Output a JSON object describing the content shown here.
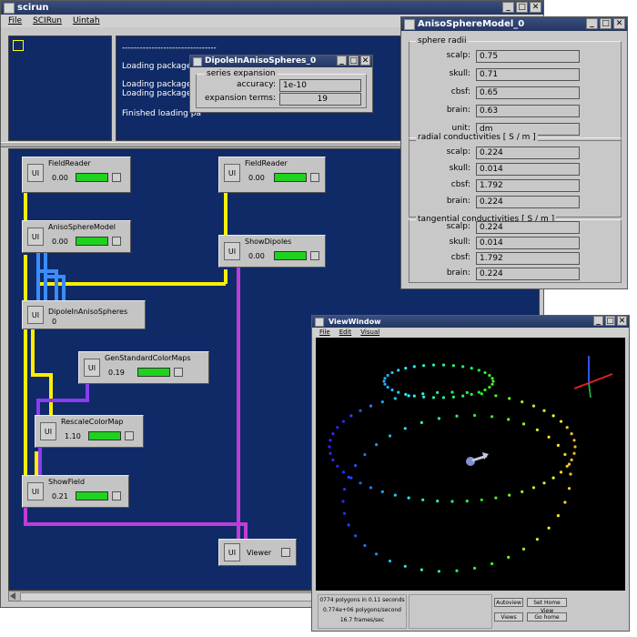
{
  "main": {
    "title": "scirun",
    "menu": [
      "File",
      "SCIRun",
      "Uintah"
    ],
    "log_lines": [
      "--------------------------------",
      "Loading packages",
      "Loading package '",
      "Loading package '",
      "Finished loading pa"
    ]
  },
  "modules": {
    "field_reader_1": {
      "name": "FieldReader",
      "time": "0.00"
    },
    "field_reader_2": {
      "name": "FieldReader",
      "time": "0.00"
    },
    "aniso_sphere_model": {
      "name": "AnisoSphereModel",
      "time": "0.00"
    },
    "show_dipoles": {
      "name": "ShowDipoles",
      "time": "0.00"
    },
    "dipole_in_aniso_spheres": {
      "name": "DipoleInAnisoSpheres",
      "time": "0"
    },
    "gen_standard_color_maps": {
      "name": "GenStandardColorMaps",
      "time": "0.19"
    },
    "rescale_color_map": {
      "name": "RescaleColorMap",
      "time": "1.10"
    },
    "show_field": {
      "name": "ShowField",
      "time": "0.21"
    },
    "viewer": {
      "name": "Viewer"
    },
    "ui_label": "UI"
  },
  "dipole_dialog": {
    "title": "DipoleInAnisoSpheres_0",
    "section": "series expansion",
    "accuracy_label": "accuracy:",
    "accuracy_value": "1e-10",
    "terms_label": "expansion terms:",
    "terms_value": "19"
  },
  "aniso_dialog": {
    "title": "AnisoSphereModel_0",
    "radii": {
      "section": "sphere radii",
      "rows": [
        {
          "label": "scalp:",
          "value": "0.75"
        },
        {
          "label": "skull:",
          "value": "0.71"
        },
        {
          "label": "cbsf:",
          "value": "0.65"
        },
        {
          "label": "brain:",
          "value": "0.63"
        },
        {
          "label": "unit:",
          "value": "dm"
        }
      ]
    },
    "radial": {
      "section": "radial conductivities  [ S / m ]",
      "rows": [
        {
          "label": "scalp:",
          "value": "0.224"
        },
        {
          "label": "skull:",
          "value": "0.014"
        },
        {
          "label": "cbsf:",
          "value": "1.792"
        },
        {
          "label": "brain:",
          "value": "0.224"
        }
      ]
    },
    "tangential": {
      "section": "tangential conductivities  [ S / m ]",
      "rows": [
        {
          "label": "scalp:",
          "value": "0.224"
        },
        {
          "label": "skull:",
          "value": "0.014"
        },
        {
          "label": "cbsf:",
          "value": "1.792"
        },
        {
          "label": "brain:",
          "value": "0.224"
        }
      ]
    }
  },
  "viewwindow": {
    "title": "ViewWindow",
    "menu": [
      "File",
      "Edit",
      "Visual"
    ],
    "status_lines": [
      "0774 polygons in 0.11 seconds",
      "0.774e+06 polygons/second",
      "16.7 frames/sec"
    ],
    "buttons": [
      "Autoview",
      "Set Home View",
      "Views",
      "Go home"
    ]
  },
  "colors": {
    "network_bg": "#0f2a66",
    "wire_yellow": "#ffee00",
    "wire_blue": "#3a8cff",
    "wire_magenta": "#c03cd8",
    "wire_purple": "#8a3cf0",
    "progress_green": "#1ed21e",
    "titlebar": "#2f4574"
  }
}
